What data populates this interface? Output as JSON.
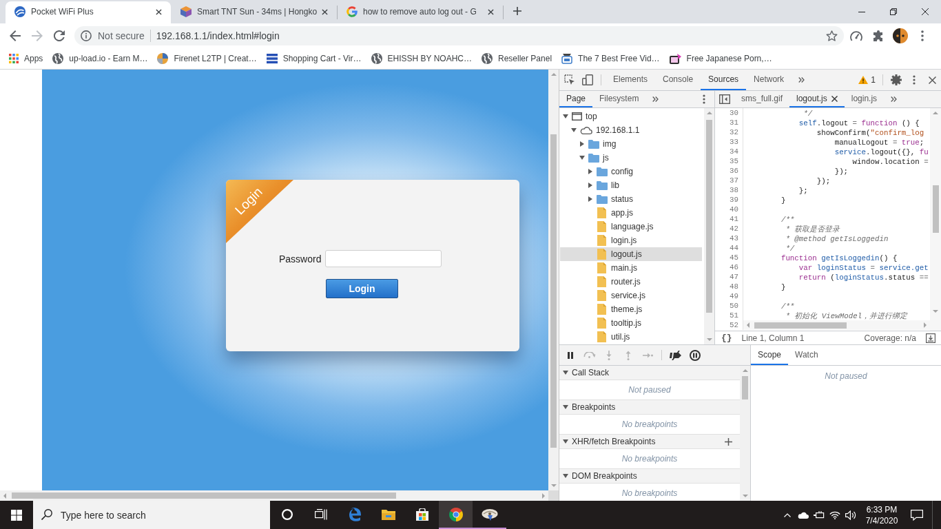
{
  "browser": {
    "tabs": [
      {
        "title": "Pocket WiFi Plus",
        "selected": true
      },
      {
        "title": "Smart TNT Sun - 34ms | Hongko",
        "selected": false
      },
      {
        "title": "how to remove auto log out - G",
        "selected": false
      }
    ],
    "address": {
      "security": "Not secure",
      "url": "192.168.1.1/index.html#login"
    },
    "bookmarks": [
      "Apps",
      "up-load.io - Earn M…",
      "Firenet L2TP | Creat…",
      "Shopping Cart - Vir…",
      "EHISSH BY NOAHC…",
      "Reseller Panel",
      "The 7 Best Free Vid…",
      "Free Japanese Porn,…"
    ]
  },
  "page": {
    "ribbon": "Login",
    "password_label": "Password",
    "login_button": "Login"
  },
  "devtools": {
    "tabs": [
      {
        "label": "Elements",
        "selected": false
      },
      {
        "label": "Console",
        "selected": false
      },
      {
        "label": "Sources",
        "selected": true
      },
      {
        "label": "Network",
        "selected": false
      }
    ],
    "warning_count": "1",
    "navigator": {
      "tabs": [
        {
          "label": "Page",
          "selected": true
        },
        {
          "label": "Filesystem",
          "selected": false
        }
      ],
      "tree": [
        {
          "label": "top",
          "kind": "frame",
          "expanded": true,
          "selected": false,
          "children": [
            {
              "label": "192.168.1.1",
              "kind": "host",
              "expanded": true,
              "selected": false,
              "children": [
                {
                  "label": "img",
                  "kind": "folder",
                  "expanded": false,
                  "selected": false
                },
                {
                  "label": "js",
                  "kind": "folder",
                  "expanded": true,
                  "selected": false,
                  "children": [
                    {
                      "label": "config",
                      "kind": "folder",
                      "expanded": false,
                      "selected": false
                    },
                    {
                      "label": "lib",
                      "kind": "folder",
                      "expanded": false,
                      "selected": false
                    },
                    {
                      "label": "status",
                      "kind": "folder",
                      "expanded": false,
                      "selected": false
                    },
                    {
                      "label": "app.js",
                      "kind": "file",
                      "selected": false
                    },
                    {
                      "label": "language.js",
                      "kind": "file",
                      "selected": false
                    },
                    {
                      "label": "login.js",
                      "kind": "file",
                      "selected": false
                    },
                    {
                      "label": "logout.js",
                      "kind": "file",
                      "selected": true
                    },
                    {
                      "label": "main.js",
                      "kind": "file",
                      "selected": false
                    },
                    {
                      "label": "router.js",
                      "kind": "file",
                      "selected": false
                    },
                    {
                      "label": "service.js",
                      "kind": "file",
                      "selected": false
                    },
                    {
                      "label": "theme.js",
                      "kind": "file",
                      "selected": false
                    },
                    {
                      "label": "tooltip.js",
                      "kind": "file",
                      "selected": false
                    },
                    {
                      "label": "util.js",
                      "kind": "file",
                      "selected": false
                    }
                  ]
                }
              ]
            }
          ]
        }
      ]
    },
    "editor": {
      "tabs": [
        {
          "label": "sms_full.gif",
          "selected": false
        },
        {
          "label": "logout.js",
          "selected": true
        },
        {
          "label": "login.js",
          "selected": false
        }
      ],
      "lines": [
        {
          "number": "30",
          "tokens": [
            {
              "text": "         */",
              "kind": "comment"
            }
          ]
        },
        {
          "number": "31",
          "tokens": [
            {
              "text": "        self",
              "kind": "variable"
            },
            {
              "text": ".logout ",
              "kind": "plain"
            },
            {
              "text": "= ",
              "kind": "operator"
            },
            {
              "text": "function",
              "kind": "keyword"
            },
            {
              "text": " () {",
              "kind": "plain"
            }
          ]
        },
        {
          "number": "32",
          "tokens": [
            {
              "text": "            showConfirm(",
              "kind": "plain"
            },
            {
              "text": "\"confirm_log",
              "kind": "string"
            }
          ]
        },
        {
          "number": "33",
          "tokens": [
            {
              "text": "                manualLogout ",
              "kind": "plain"
            },
            {
              "text": "= ",
              "kind": "operator"
            },
            {
              "text": "true",
              "kind": "keyword"
            },
            {
              "text": ";",
              "kind": "plain"
            }
          ]
        },
        {
          "number": "34",
          "tokens": [
            {
              "text": "                service",
              "kind": "variable"
            },
            {
              "text": ".logout({}, ",
              "kind": "plain"
            },
            {
              "text": "fu",
              "kind": "keyword"
            }
          ]
        },
        {
          "number": "35",
          "tokens": [
            {
              "text": "                    window.location ",
              "kind": "plain"
            },
            {
              "text": "=",
              "kind": "operator"
            }
          ]
        },
        {
          "number": "36",
          "tokens": [
            {
              "text": "                });",
              "kind": "plain"
            }
          ]
        },
        {
          "number": "37",
          "tokens": [
            {
              "text": "            });",
              "kind": "plain"
            }
          ]
        },
        {
          "number": "38",
          "tokens": [
            {
              "text": "        };",
              "kind": "plain"
            }
          ]
        },
        {
          "number": "39",
          "tokens": [
            {
              "text": "    }",
              "kind": "plain"
            }
          ]
        },
        {
          "number": "40"
        },
        {
          "number": "41",
          "tokens": [
            {
              "text": "    /**",
              "kind": "comment"
            }
          ]
        },
        {
          "number": "42",
          "tokens": [
            {
              "text": "     * 获取是否登录",
              "kind": "comment"
            }
          ]
        },
        {
          "number": "43",
          "tokens": [
            {
              "text": "     * @method getIsLoggedin",
              "kind": "comment"
            }
          ]
        },
        {
          "number": "44",
          "tokens": [
            {
              "text": "     */",
              "kind": "comment"
            }
          ]
        },
        {
          "number": "45",
          "tokens": [
            {
              "text": "    function ",
              "kind": "keyword"
            },
            {
              "text": "getIsLoggedin",
              "kind": "variable"
            },
            {
              "text": "() {",
              "kind": "plain"
            }
          ]
        },
        {
          "number": "46",
          "tokens": [
            {
              "text": "        var ",
              "kind": "keyword"
            },
            {
              "text": "loginStatus ",
              "kind": "variable"
            },
            {
              "text": "= ",
              "kind": "operator"
            },
            {
              "text": "service.get",
              "kind": "variable"
            }
          ]
        },
        {
          "number": "47",
          "tokens": [
            {
              "text": "        return ",
              "kind": "keyword"
            },
            {
              "text": "(",
              "kind": "plain"
            },
            {
              "text": "loginStatus",
              "kind": "variable"
            },
            {
              "text": ".status ",
              "kind": "plain"
            },
            {
              "text": "==",
              "kind": "operator"
            }
          ]
        },
        {
          "number": "48",
          "tokens": [
            {
              "text": "    }",
              "kind": "plain"
            }
          ]
        },
        {
          "number": "49"
        },
        {
          "number": "50",
          "tokens": [
            {
              "text": "    /**",
              "kind": "comment"
            }
          ]
        },
        {
          "number": "51",
          "tokens": [
            {
              "text": "     * 初始化 ViewModel，并进行绑定",
              "kind": "comment"
            }
          ]
        },
        {
          "number": "52"
        }
      ],
      "pretty_print": "{}",
      "cursor": "Line 1, Column 1",
      "coverage": "Coverage: n/a"
    },
    "debugger": {
      "controls": [
        {
          "disabled": false
        },
        {
          "disabled": true
        },
        {
          "disabled": true
        },
        {
          "disabled": true
        },
        {
          "disabled": true
        },
        {
          "disabled": false
        },
        {
          "disabled": false
        }
      ],
      "sections": [
        {
          "title": "Call Stack",
          "expanded": true,
          "add_button": false,
          "message": "Not paused"
        },
        {
          "title": "Breakpoints",
          "expanded": true,
          "add_button": false,
          "message": "No breakpoints"
        },
        {
          "title": "XHR/fetch Breakpoints",
          "expanded": true,
          "add_button": true,
          "message": "No breakpoints"
        },
        {
          "title": "DOM Breakpoints",
          "expanded": true,
          "add_button": false,
          "message": "No breakpoints"
        }
      ],
      "side_tabs": [
        {
          "label": "Scope",
          "selected": true
        },
        {
          "label": "Watch",
          "selected": false
        }
      ],
      "side_message": "Not paused"
    }
  },
  "taskbar": {
    "search": {
      "placeholder": "Type here to search"
    },
    "apps": [
      {
        "running": false,
        "active": false
      },
      {
        "running": false,
        "active": false
      },
      {
        "running": false,
        "active": false
      },
      {
        "running": true,
        "active": true
      },
      {
        "running": true,
        "active": false
      }
    ],
    "time": "6:33 PM",
    "date": "7/4/2020"
  }
}
